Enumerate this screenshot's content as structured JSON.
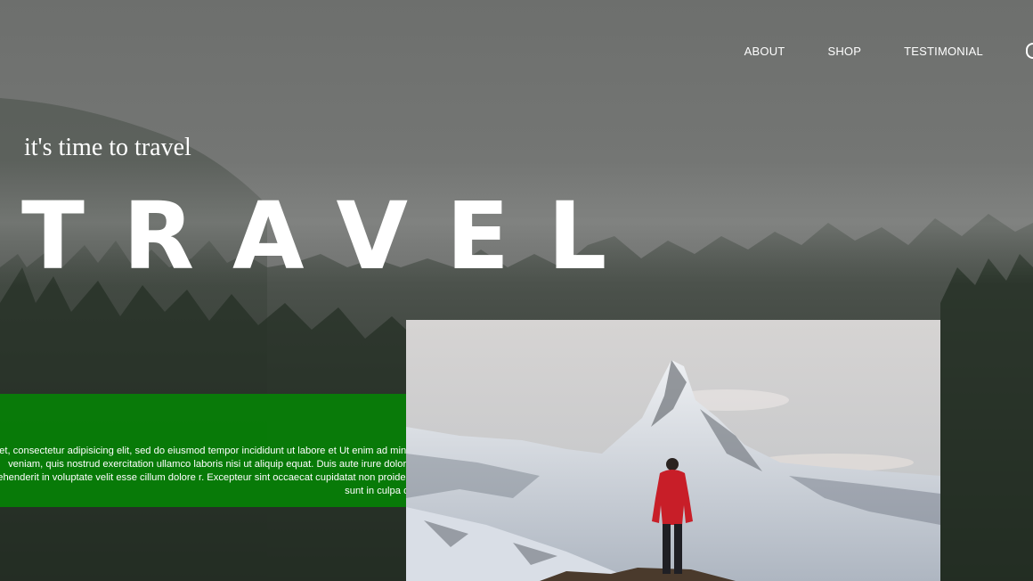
{
  "nav": {
    "items": [
      "ABOUT",
      "SHOP",
      "TESTIMONIAL"
    ]
  },
  "hero": {
    "tagline": "it's time to travel",
    "title": "TRAVEL"
  },
  "intro": {
    "text": "amet, consectetur adipisicing elit, sed do eiusmod tempor incididunt ut labore et Ut enim ad minim veniam, quis nostrud exercitation ullamco laboris nisi ut aliquip equat. Duis aute irure dolor in reprehenderit in voluptate velit esse cillum dolore r. Excepteur sint occaecat cupidatat non proident, sunt in culpa qui"
  },
  "colors": {
    "accent_green": "#068006",
    "jacket_red": "#c81e28"
  },
  "icons": {
    "nav_edge": "circle-outline-icon"
  }
}
